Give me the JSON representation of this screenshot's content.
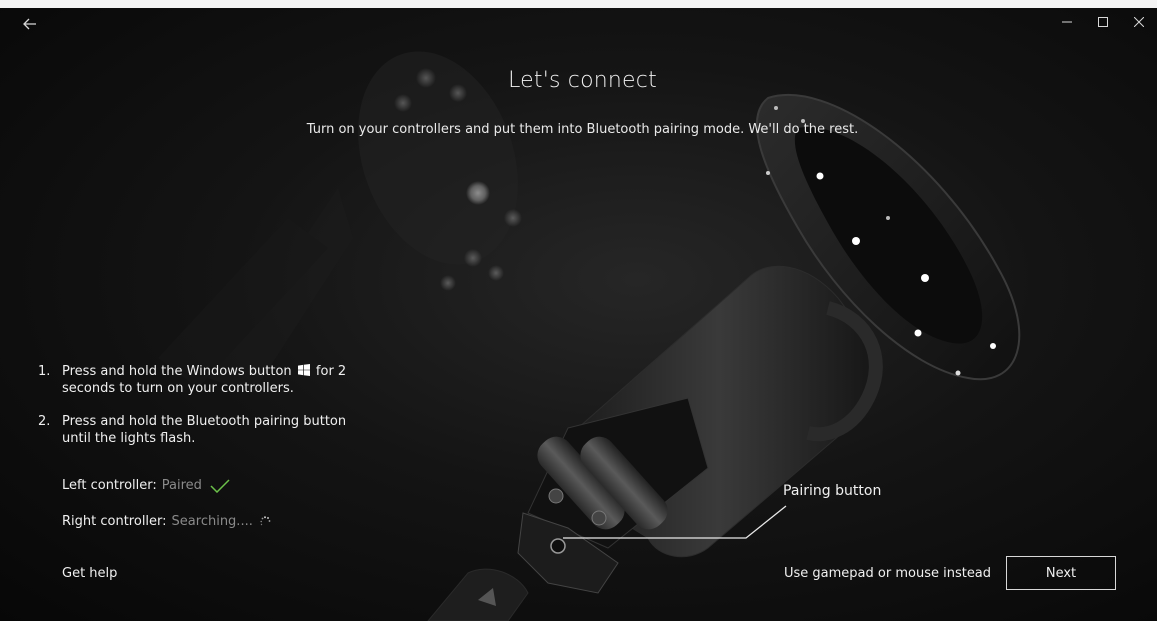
{
  "window": {
    "back_label": "←",
    "minimize_label": "–",
    "maximize_label": "☐",
    "close_label": "✕"
  },
  "main": {
    "title": "Let's connect",
    "subtitle": "Turn on your controllers and put them into Bluetooth pairing mode. We'll do the rest."
  },
  "steps": [
    {
      "number": "1.",
      "text_before": "Press and hold the Windows button",
      "text_after": "for 2 seconds to turn on your controllers."
    },
    {
      "number": "2.",
      "text": "Press and hold the Bluetooth pairing button until the lights flash."
    }
  ],
  "status": {
    "left_label": "Left controller:",
    "left_value": "Paired",
    "right_label": "Right controller:",
    "right_value": "Searching....",
    "success_color": "#6cc24a",
    "muted_color": "#8a8a8a"
  },
  "callout": {
    "label": "Pairing button"
  },
  "footer": {
    "help": "Get help",
    "alt_input": "Use gamepad or mouse instead",
    "next": "Next"
  },
  "icons": {
    "back": "back-arrow-icon",
    "windows": "windows-logo-icon",
    "check": "check-icon",
    "spinner": "spinner-icon"
  }
}
